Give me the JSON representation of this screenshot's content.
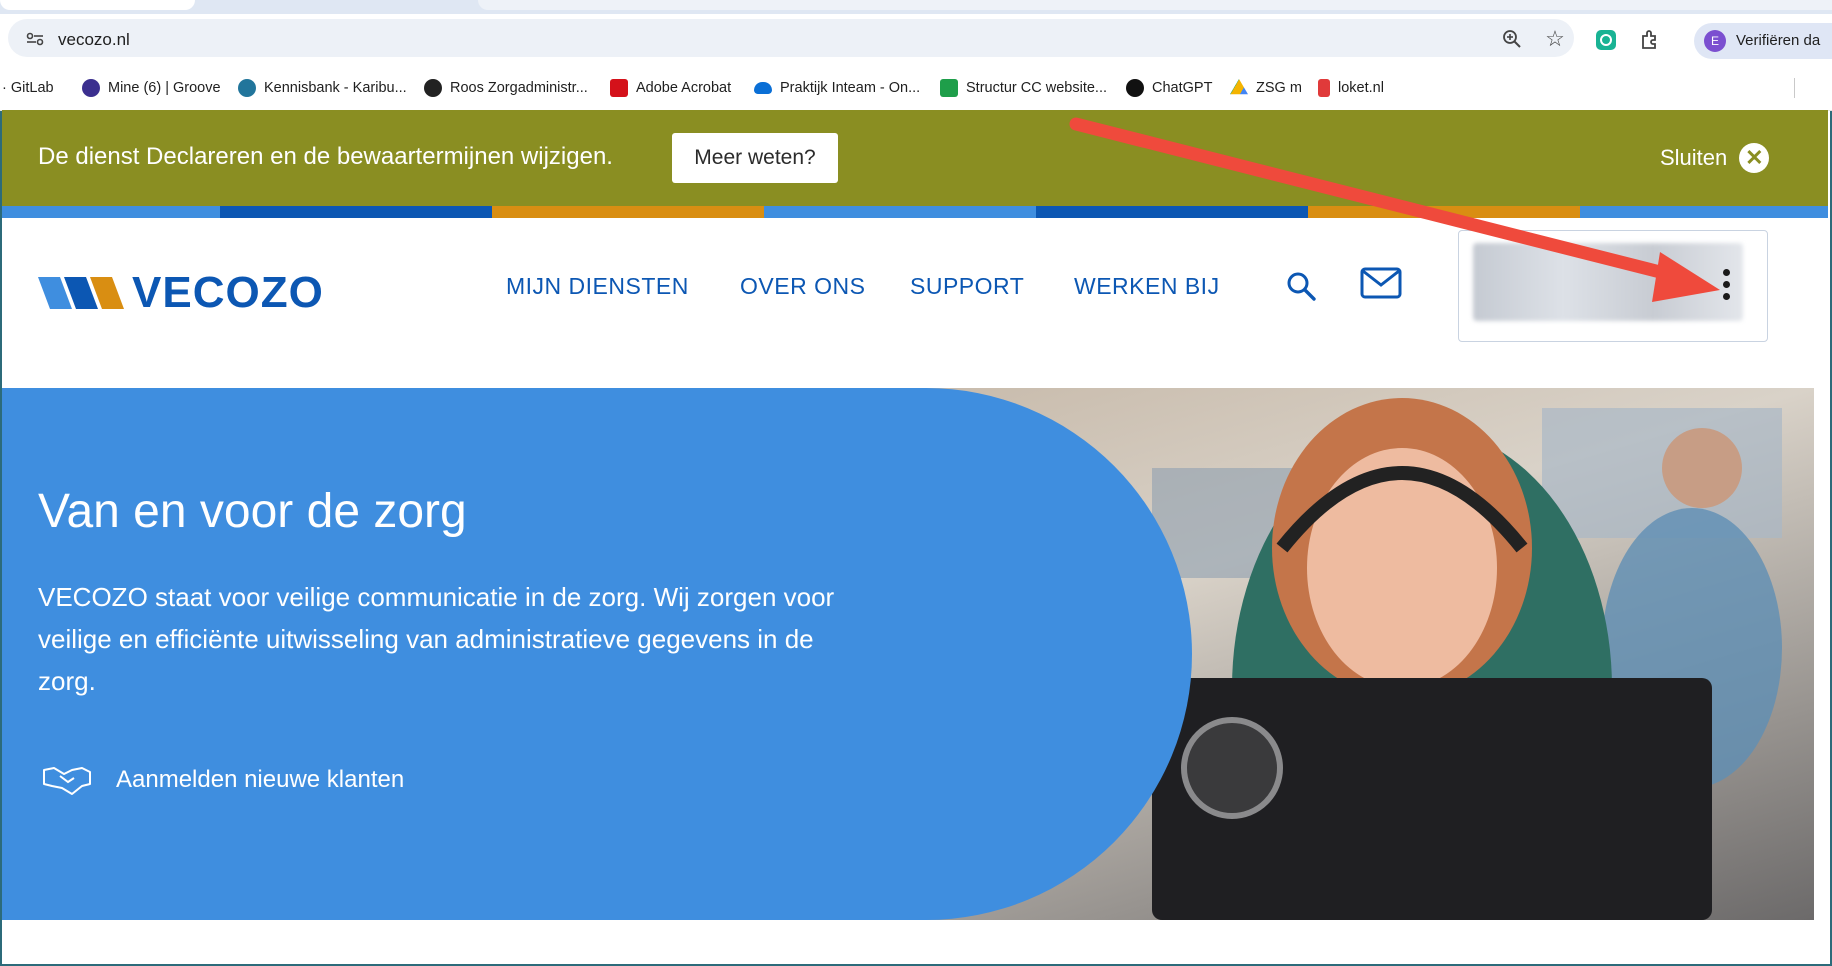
{
  "browser": {
    "url": "vecozo.nl",
    "profile_label": "Verifiëren da",
    "profile_initial": "E",
    "bookmarks": [
      {
        "label": "· GitLab",
        "color": "#e24329"
      },
      {
        "label": "Mine (6) | Groove",
        "color": "#3b2f8f"
      },
      {
        "label": "Kennisbank - Karibu...",
        "color": "#21759b"
      },
      {
        "label": "Roos Zorgadministr...",
        "color": "#222222"
      },
      {
        "label": "Adobe Acrobat",
        "color": "#d4111a"
      },
      {
        "label": "Praktijk Inteam - On...",
        "color": "#0a6fd6"
      },
      {
        "label": "Structur CC website...",
        "color": "#1e9e4a"
      },
      {
        "label": "ChatGPT",
        "color": "#111111"
      },
      {
        "label": "ZSG m",
        "color": "#f4b400"
      },
      {
        "label": "loket.nl",
        "color": "#e03a3a"
      }
    ]
  },
  "notice": {
    "text": "De dienst Declareren en de bewaartermijnen wijzigen.",
    "button_label": "Meer weten?",
    "close_label": "Sluiten"
  },
  "header": {
    "logo_text": "VECOZO",
    "nav": [
      "MIJN DIENSTEN",
      "OVER ONS",
      "SUPPORT",
      "WERKEN BIJ"
    ]
  },
  "hero": {
    "title": "Van en voor de zorg",
    "text": "VECOZO staat voor veilige communicatie in de zorg. Wij zorgen voor veilige en efficiënte uitwisseling van administratieve gegevens in de zorg.",
    "link_label": "Aanmelden nieuwe klanten"
  },
  "colors": {
    "brand_blue": "#0c57b3",
    "notice_olive": "#8a8e22",
    "hero_blue": "#3f8edf",
    "stripe_orange": "#d98e12",
    "annotation_arrow": "#ef4a3c"
  }
}
